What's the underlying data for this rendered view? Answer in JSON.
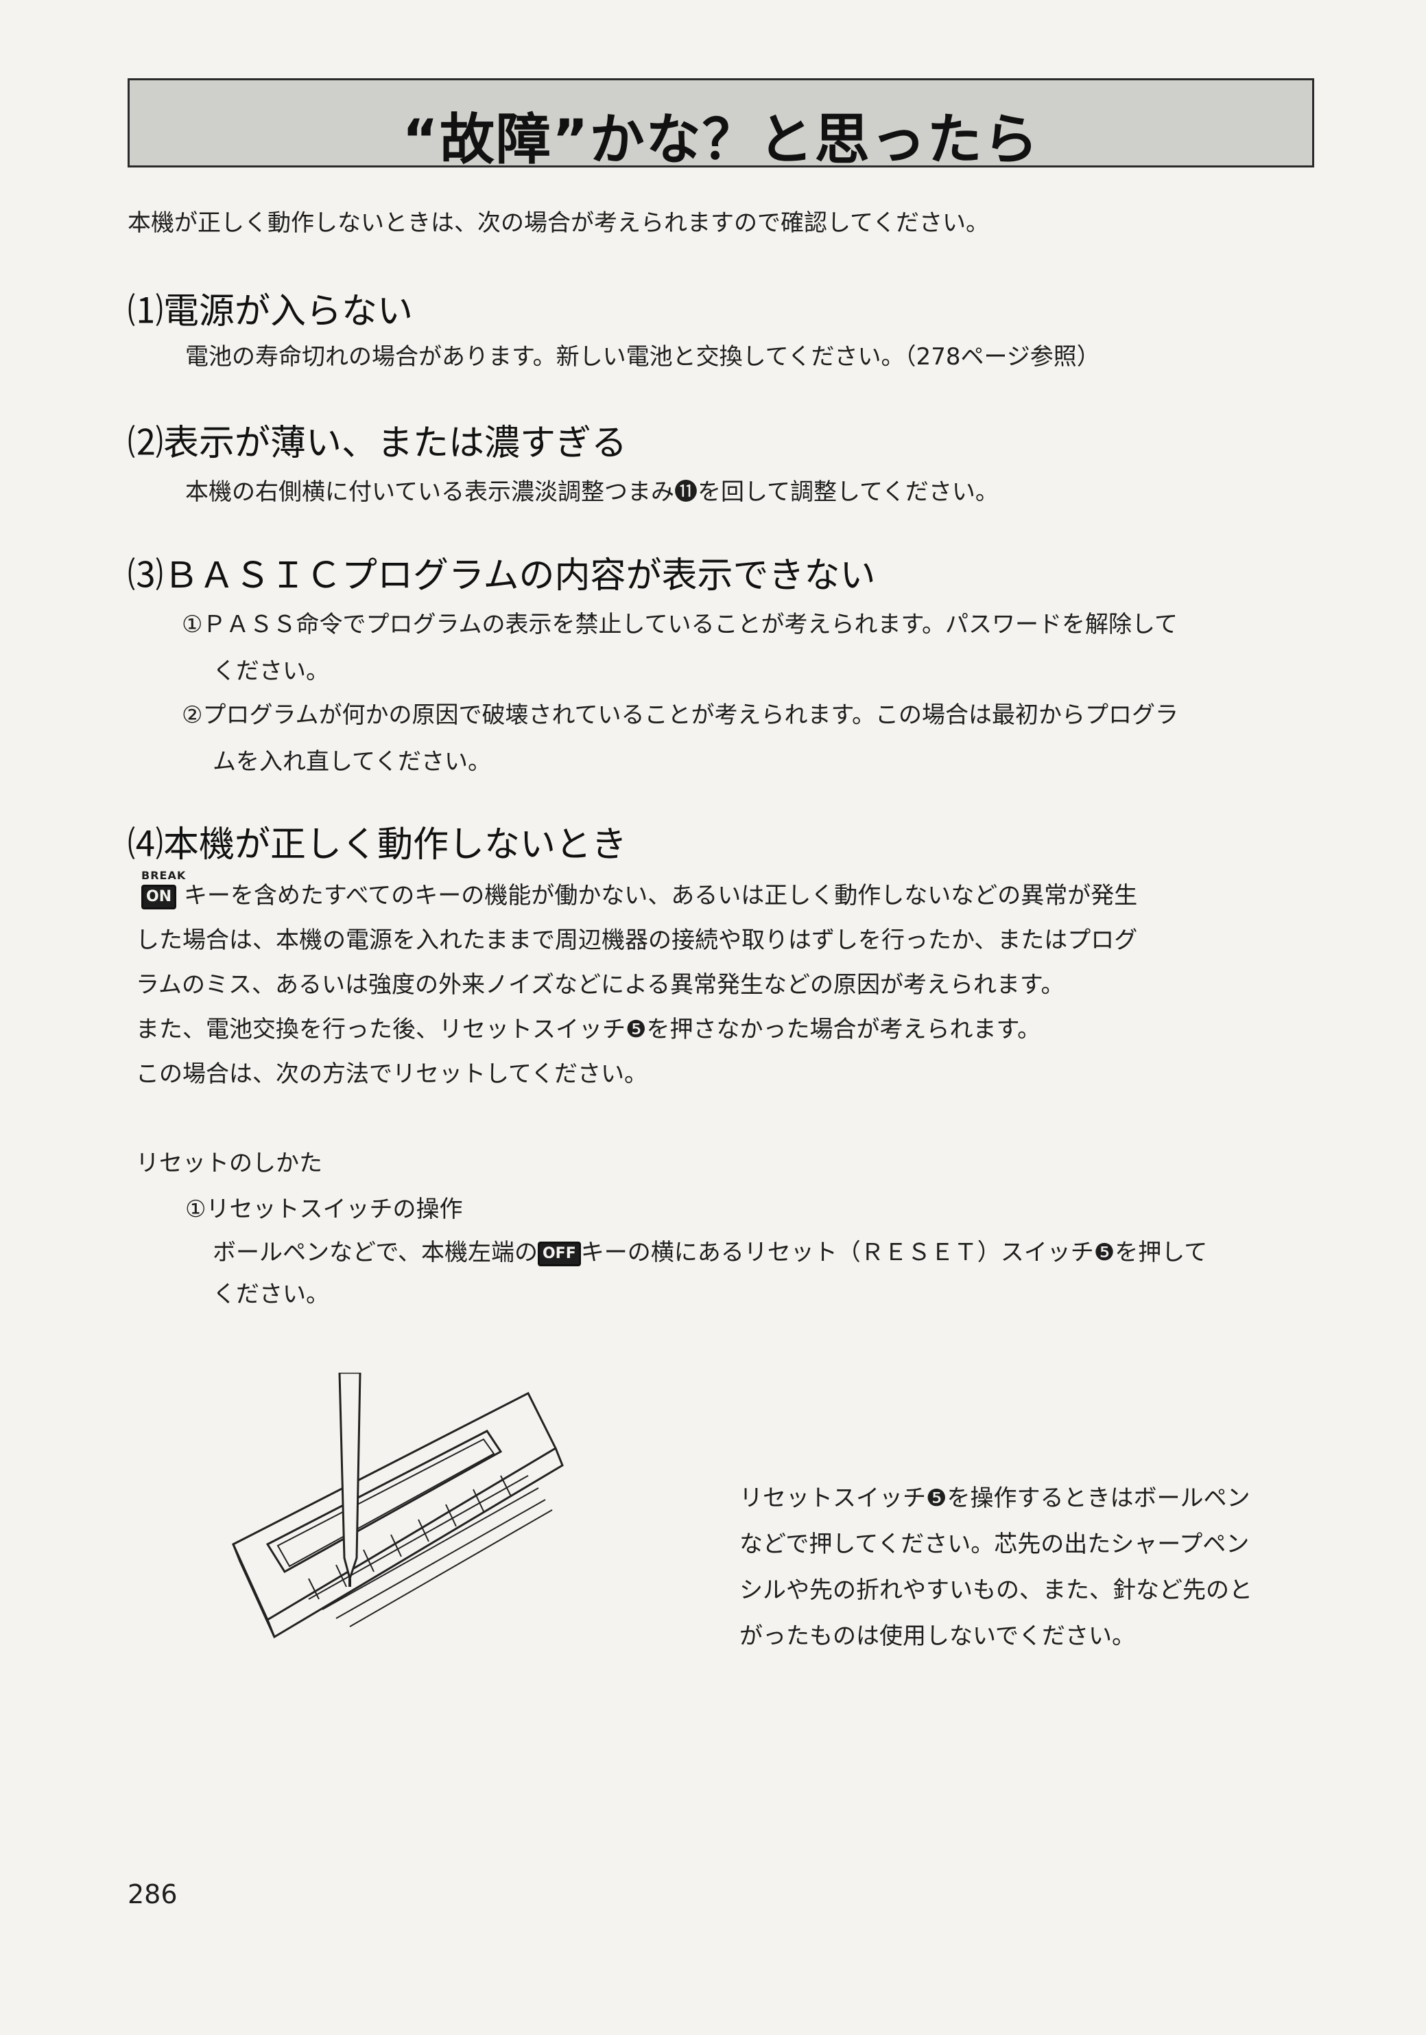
{
  "header": {
    "title": "“故障”かな？と思ったら"
  },
  "intro": "本機が正しく動作しないときは、次の場合が考えられますので確認してください。",
  "sections": [
    {
      "heading": "⑴電源が入らない",
      "lines": [
        "電池の寿命切れの場合があります。新しい電池と交換してください。（278ページ参照）"
      ]
    },
    {
      "heading": "⑵表示が薄い、または濃すぎる",
      "lines": [
        "本機の右側横に付いている表示濃淡調整つまみ⓫を回して調整してください。"
      ]
    },
    {
      "heading": "⑶ＢＡＳＩＣプログラムの内容が表示できない",
      "lines": [
        "①ＰＡＳＳ命令でプログラムの表示を禁止していることが考えられます。パスワードを解除して",
        "ください。",
        "②プログラムが何かの原因で破壊されていることが考えられます。この場合は最初からプログラ",
        "ムを入れ直してください。"
      ]
    },
    {
      "heading": "⑷本機が正しく動作しないとき",
      "break_label": "BREAK",
      "key_on": "ON",
      "lines": [
        "キーを含めたすべてのキーの機能が働かない、あるいは正しく動作しないなどの異常が発生",
        "した場合は、本機の電源を入れたままで周辺機器の接続や取りはずしを行ったか、またはプログ",
        "ラムのミス、あるいは強度の外来ノイズなどによる異常発生などの原因が考えられます。",
        "また、電池交換を行った後、リセットスイッチ❺を押さなかった場合が考えられます。",
        "この場合は、次の方法でリセットしてください。"
      ]
    }
  ],
  "reset": {
    "title": "リセットのしかた",
    "step_title": "①リセットスイッチの操作",
    "step_line1_a": "ボールペンなどで、本機左端の",
    "key_off": "OFF",
    "step_line1_b": "キーの横にあるリセット（ＲＥＳＥＴ）スイッチ❺を押して",
    "step_line2": "ください。"
  },
  "caution": [
    "リセットスイッチ❺を操作するときはボールペン",
    "などで押してください。芯先の出たシャープペン",
    "シルや先の折れやすいもの、また、針など先のと",
    "がったものは使用しないでください。"
  ],
  "page_number": "286"
}
